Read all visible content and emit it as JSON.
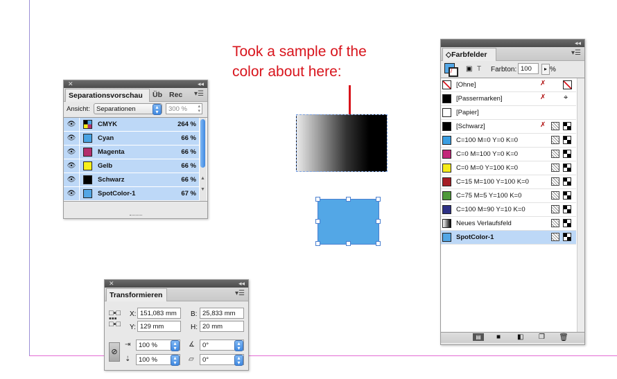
{
  "annotation": {
    "text": "Took a sample of the\ncolor about here:"
  },
  "separations": {
    "title": "Separationsvorschau",
    "tabs": [
      "Separationsvorschau",
      "Üb",
      "Rec"
    ],
    "view_label": "Ansicht:",
    "view_value": "Separationen",
    "zoom_value": "300 %",
    "rows": [
      {
        "name": "CMYK",
        "pct": "264 %",
        "color": "multi"
      },
      {
        "name": "Cyan",
        "pct": "66 %",
        "color": "#4aa3e3"
      },
      {
        "name": "Magenta",
        "pct": "66 %",
        "color": "#b3306e"
      },
      {
        "name": "Gelb",
        "pct": "66 %",
        "color": "#f7ef1a"
      },
      {
        "name": "Schwarz",
        "pct": "66 %",
        "color": "#000000"
      },
      {
        "name": "SpotColor-1",
        "pct": "67 %",
        "color": "#53a7e6"
      }
    ]
  },
  "transform": {
    "title": "Transformieren",
    "x_label": "X:",
    "x_value": "151,083 mm",
    "y_label": "Y:",
    "y_value": "129 mm",
    "b_label": "B:",
    "b_value": "25,833 mm",
    "h_label": "H:",
    "h_value": "20 mm",
    "scale_x": "100 %",
    "scale_y": "100 %",
    "rotate": "0°",
    "shear": "0°"
  },
  "swatches": {
    "title": "Farbfelder",
    "tint_label": "Farbton:",
    "tint_value": "100",
    "tint_unit": "%",
    "items": [
      {
        "name": "[Ohne]",
        "color": "none"
      },
      {
        "name": "[Passermarken]",
        "color": "#000000"
      },
      {
        "name": "[Papier]",
        "color": "#ffffff"
      },
      {
        "name": "[Schwarz]",
        "color": "#000000"
      },
      {
        "name": "C=100 M=0 Y=0 K=0",
        "color": "#3a9ee2"
      },
      {
        "name": "C=0 M=100 Y=0 K=0",
        "color": "#c2277a"
      },
      {
        "name": "C=0 M=0 Y=100 K=0",
        "color": "#f6ec19"
      },
      {
        "name": "C=15 M=100 Y=100 K=0",
        "color": "#a51d24"
      },
      {
        "name": "C=75 M=5 Y=100 K=0",
        "color": "#4f9a3a"
      },
      {
        "name": "C=100 M=90 Y=10 K=0",
        "color": "#2e3186"
      },
      {
        "name": "Neues Verlaufsfeld",
        "color": "gradient"
      },
      {
        "name": "SpotColor-1",
        "color": "#53a7e6"
      }
    ]
  }
}
